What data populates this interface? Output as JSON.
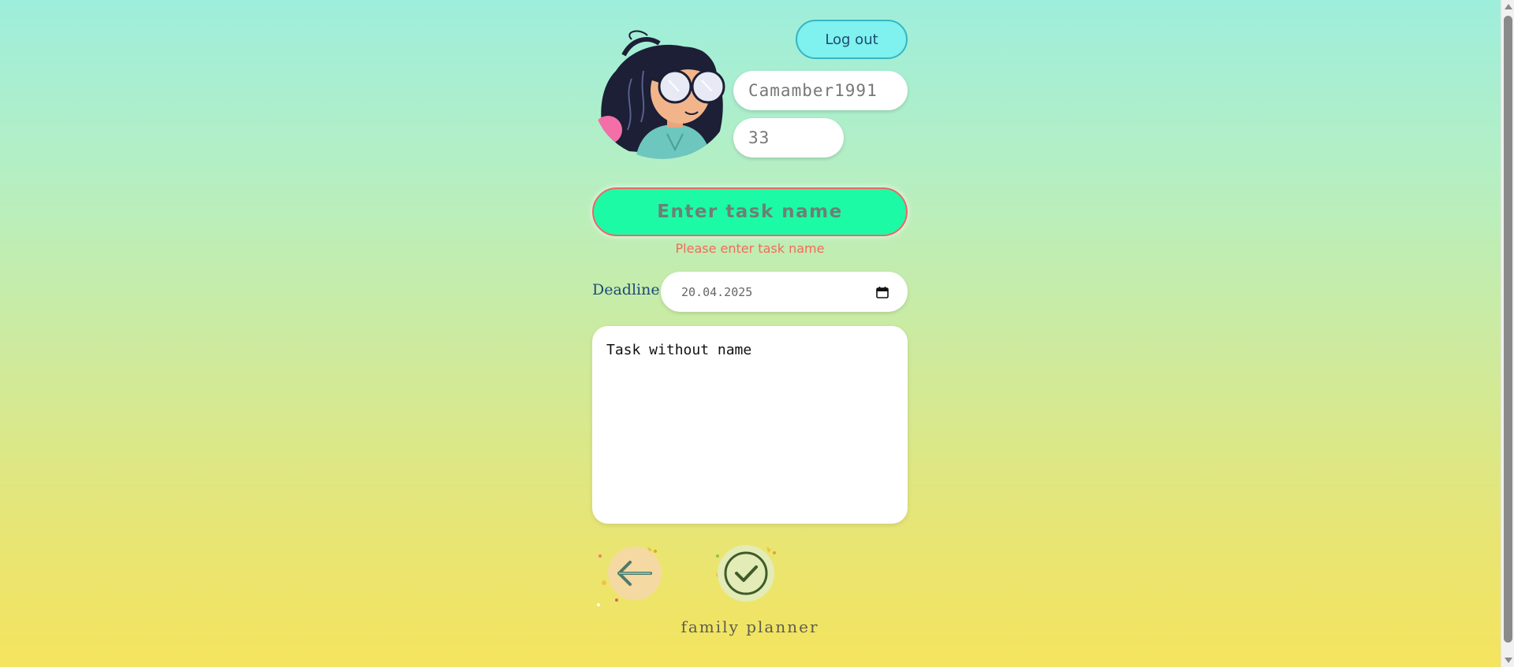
{
  "header": {
    "logout_label": "Log out",
    "username": "Camamber1991",
    "age": "33"
  },
  "form": {
    "task_name_placeholder": "Enter task name",
    "error_message": "Please enter task name",
    "deadline_label": "Deadline:",
    "deadline_value": "20.04.2025",
    "description_value": "Task without name"
  },
  "icons": {
    "back": "arrow-left-icon",
    "confirm": "checkmark-icon",
    "calendar": "calendar-icon"
  },
  "colors": {
    "task_field_bg": "#1dfaa6",
    "error": "#f36a5c",
    "logout_bg": "#7ff1ee"
  },
  "footer": {
    "brand": "family planner"
  }
}
